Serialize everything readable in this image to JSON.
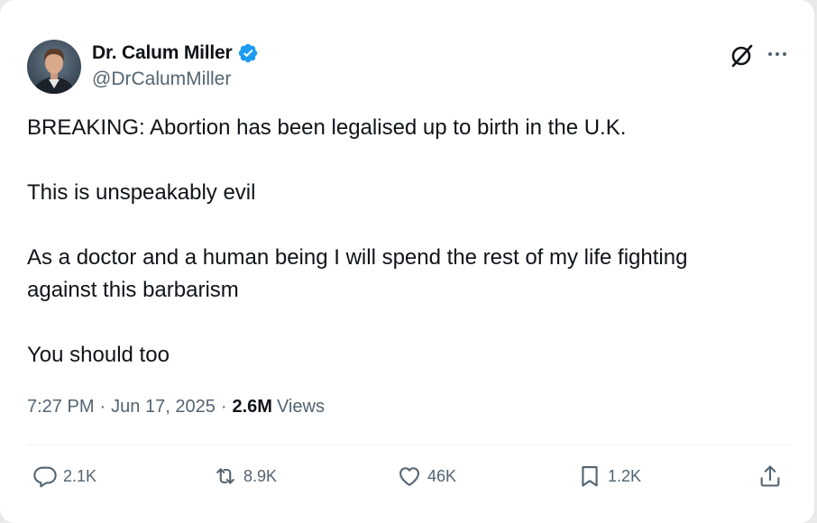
{
  "author": {
    "display_name": "Dr. Calum Miller",
    "handle": "@DrCalumMiller",
    "verified": true,
    "avatar_icon": "profile-photo",
    "verified_color": "#1d9bf0"
  },
  "header_icons": {
    "grok": "grok-icon",
    "more": "more-options-icon"
  },
  "tweet": {
    "paragraphs": [
      "BREAKING: Abortion has been legalised up to birth in the U.K.",
      "This is unspeakably evil",
      "As a doctor and a human being I will spend the rest of my life fighting\nagainst this barbarism",
      "You should too"
    ],
    "time": "7:27 PM",
    "date": "Jun 17, 2025",
    "separator": "·",
    "views_count": "2.6M",
    "views_label": "Views"
  },
  "actions": {
    "reply_count": "2.1K",
    "retweet_count": "8.9K",
    "like_count": "46K",
    "bookmark_count": "1.2K"
  },
  "colors": {
    "text_primary": "#0f1419",
    "text_secondary": "#536471",
    "accent": "#1d9bf0"
  }
}
